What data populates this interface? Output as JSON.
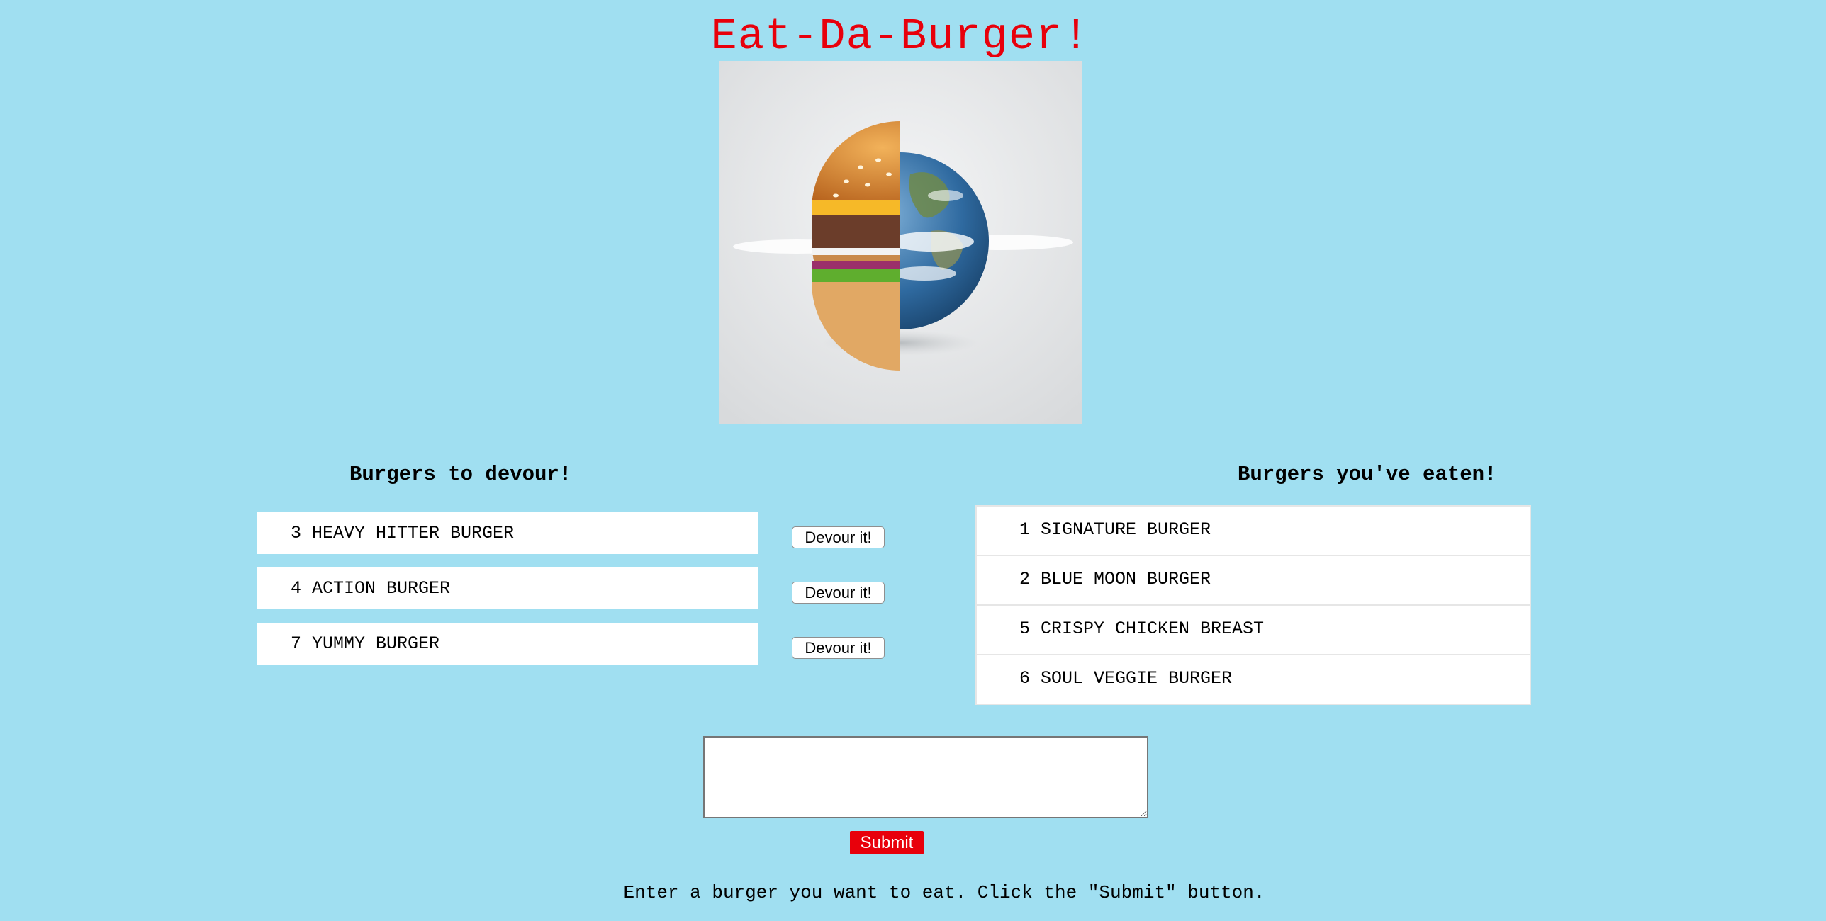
{
  "page_title": "Eat-Da-Burger!",
  "hero_image": {
    "alt": "burger-earth-image"
  },
  "devour_section": {
    "heading": "Burgers to devour!",
    "button_label": "Devour it!",
    "items": [
      {
        "id": "3",
        "name": "HEAVY HITTER BURGER"
      },
      {
        "id": "4",
        "name": "ACTION BURGER"
      },
      {
        "id": "7",
        "name": "YUMMY BURGER"
      }
    ]
  },
  "eaten_section": {
    "heading": "Burgers you've eaten!",
    "items": [
      {
        "id": "1",
        "name": "SIGNATURE BURGER"
      },
      {
        "id": "2",
        "name": "BLUE MOON BURGER"
      },
      {
        "id": "5",
        "name": "CRISPY CHICKEN BREAST"
      },
      {
        "id": "6",
        "name": "SOUL VEGGIE BURGER"
      }
    ]
  },
  "form": {
    "input_value": "",
    "submit_label": "Submit",
    "instructions": "Enter a burger you want to eat. Click the \"Submit\" button."
  },
  "colors": {
    "background": "#a0dff1",
    "title": "#e8000b",
    "submit_button": "#e8000b"
  }
}
